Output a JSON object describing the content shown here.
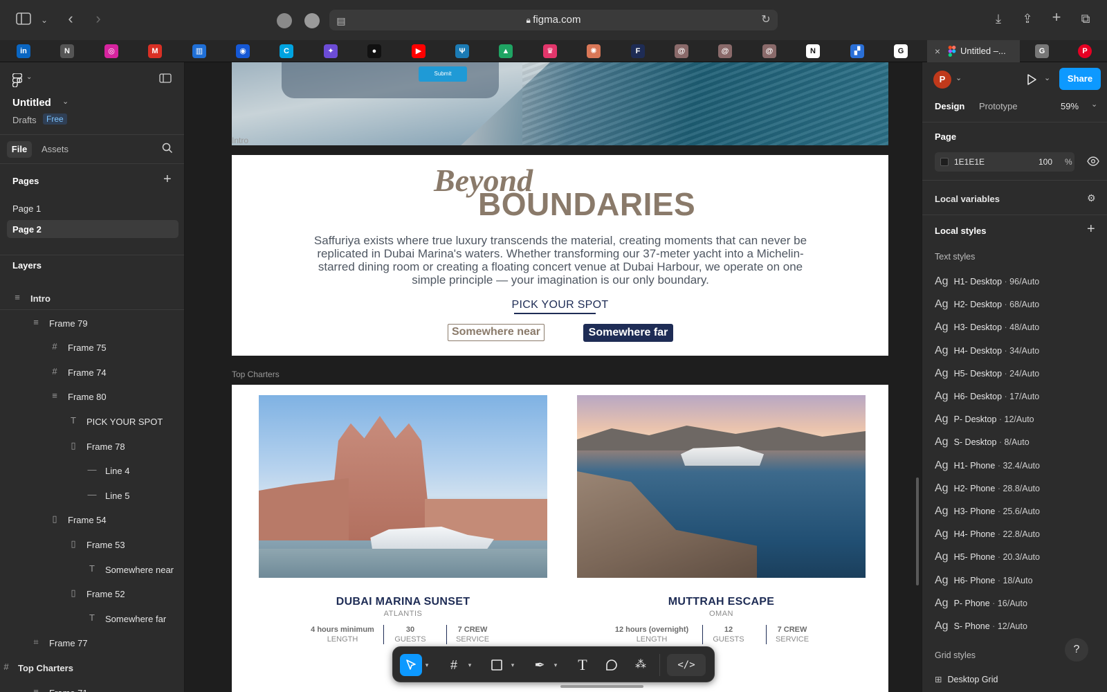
{
  "browser": {
    "url": "figma.com",
    "active_tab_title": "Untitled –..."
  },
  "favicons": [
    {
      "name": "linkedin",
      "glyph": "in",
      "color": "#0a66c2"
    },
    {
      "name": "notion",
      "glyph": "N",
      "color": "#555555"
    },
    {
      "name": "instagram",
      "glyph": "◎",
      "color": "#d6249f"
    },
    {
      "name": "gmail",
      "glyph": "M",
      "color": "#d93025"
    },
    {
      "name": "analytics",
      "glyph": "▥",
      "color": "#1f6fd6"
    },
    {
      "name": "app-blue",
      "glyph": "◉",
      "color": "#1558d6"
    },
    {
      "name": "canva",
      "glyph": "C",
      "color": "#00a3e0"
    },
    {
      "name": "app-purple",
      "glyph": "✦",
      "color": "#6c4cd6"
    },
    {
      "name": "app-black",
      "glyph": "●",
      "color": "#111111"
    },
    {
      "name": "youtube",
      "glyph": "▶",
      "color": "#ff0000"
    },
    {
      "name": "app-teal",
      "glyph": "Ψ",
      "color": "#1b7bb5"
    },
    {
      "name": "google-drive",
      "glyph": "▲",
      "color": "#1fa463"
    },
    {
      "name": "app-crown",
      "glyph": "♛",
      "color": "#e2366b"
    },
    {
      "name": "claude",
      "glyph": "✺",
      "color": "#d97757"
    },
    {
      "name": "app-f",
      "glyph": "F",
      "color": "#1e2c55"
    },
    {
      "name": "app-swirl-1",
      "glyph": "@",
      "color": "#8a6a6a"
    },
    {
      "name": "app-swirl-2",
      "glyph": "@",
      "color": "#8a6a6a"
    },
    {
      "name": "app-swirl-3",
      "glyph": "@",
      "color": "#8a6a6a"
    },
    {
      "name": "app-n",
      "glyph": "N",
      "color": "#ffffff"
    },
    {
      "name": "app-bars",
      "glyph": "▞",
      "color": "#2a6fd6"
    },
    {
      "name": "google",
      "glyph": "G",
      "color": "#ffffff"
    }
  ],
  "left_panel": {
    "file_name": "Untitled",
    "location": "Drafts",
    "plan_badge": "Free",
    "tab_file": "File",
    "tab_assets": "Assets",
    "pages_heading": "Pages",
    "pages": [
      "Page 1",
      "Page 2"
    ],
    "layers_heading": "Layers",
    "layers": [
      {
        "name": "Intro",
        "icon": "≡"
      },
      {
        "name": "Frame 79",
        "icon": "≡"
      },
      {
        "name": "Frame 75",
        "icon": "#"
      },
      {
        "name": "Frame 74",
        "icon": "#"
      },
      {
        "name": "Frame 80",
        "icon": "≡"
      },
      {
        "name": "PICK YOUR SPOT",
        "icon": "T"
      },
      {
        "name": "Frame 78",
        "icon": "▯"
      },
      {
        "name": "Line 4",
        "icon": "—"
      },
      {
        "name": "Line 5",
        "icon": "—"
      },
      {
        "name": "Frame 54",
        "icon": "▯"
      },
      {
        "name": "Frame 53",
        "icon": "▯"
      },
      {
        "name": "Somewhere near",
        "icon": "T"
      },
      {
        "name": "Frame 52",
        "icon": "▯"
      },
      {
        "name": "Somewhere far",
        "icon": "T"
      },
      {
        "name": "Frame 77",
        "icon": "⌗"
      },
      {
        "name": "Top Charters",
        "icon": "#"
      },
      {
        "name": "Frame 71",
        "icon": "≡"
      }
    ]
  },
  "canvas": {
    "submit_label": "Submit",
    "intro_label": "Intro",
    "beyond": "Beyond",
    "boundaries": "BOUNDARIES",
    "intro_body": "Saffuriya exists where true luxury transcends the material, creating moments that can never be replicated in Dubai Marina's waters. Whether transforming our 37-meter yacht into a Michelin-starred dining room or creating a floating concert venue at Dubai Harbour, we operate on one simple principle — your imagination is our only boundary.",
    "pick_spot": "PICK YOUR SPOT",
    "btn_near": "Somewhere near",
    "btn_far": "Somewhere far",
    "top_charters_label": "Top Charters",
    "cards": [
      {
        "title": "DUBAI MARINA SUNSET",
        "subtitle": "ATLANTIS",
        "stats": [
          {
            "value": "4 hours minimum",
            "label": "LENGTH"
          },
          {
            "value": "30",
            "label": "GUESTS"
          },
          {
            "value": "7 CREW",
            "label": "SERVICE"
          }
        ]
      },
      {
        "title": "MUTTRAH ESCAPE",
        "subtitle": "OMAN",
        "stats": [
          {
            "value": "12 hours (overnight)",
            "label": "LENGTH"
          },
          {
            "value": "12",
            "label": "GUESTS"
          },
          {
            "value": "7 CREW",
            "label": "SERVICE"
          }
        ]
      }
    ]
  },
  "right_panel": {
    "avatar_initial": "P",
    "avatar_color": "#c0391b",
    "share_label": "Share",
    "tab_design": "Design",
    "tab_prototype": "Prototype",
    "zoom": "59%",
    "page_heading": "Page",
    "page_color_hex": "1E1E1E",
    "page_opacity": "100",
    "percent_sign": "%",
    "local_variables": "Local variables",
    "local_styles": "Local styles",
    "text_styles_heading": "Text styles",
    "text_styles": [
      {
        "name": "H1- Desktop",
        "size": "96/Auto"
      },
      {
        "name": "H2- Desktop",
        "size": "68/Auto"
      },
      {
        "name": "H3- Desktop",
        "size": "48/Auto"
      },
      {
        "name": "H4- Desktop",
        "size": "34/Auto"
      },
      {
        "name": "H5- Desktop",
        "size": "24/Auto"
      },
      {
        "name": "H6- Desktop",
        "size": "17/Auto"
      },
      {
        "name": "P- Desktop",
        "size": "12/Auto"
      },
      {
        "name": "S- Desktop",
        "size": "8/Auto"
      },
      {
        "name": "H1- Phone",
        "size": "32.4/Auto"
      },
      {
        "name": "H2- Phone",
        "size": "28.8/Auto"
      },
      {
        "name": "H3- Phone",
        "size": "25.6/Auto"
      },
      {
        "name": "H4- Phone",
        "size": "22.8/Auto"
      },
      {
        "name": "H5- Phone",
        "size": "20.3/Auto"
      },
      {
        "name": "H6- Phone",
        "size": "18/Auto"
      },
      {
        "name": "P- Phone",
        "size": "16/Auto"
      },
      {
        "name": "S- Phone",
        "size": "12/Auto"
      }
    ],
    "ag_glyph": "Ag",
    "grid_styles_heading": "Grid styles",
    "grid_style_first": "Desktop Grid",
    "help_glyph": "?"
  },
  "colors": {
    "accent_blue": "#0d99ff",
    "brand_navy": "#1e2c55",
    "brand_taupe": "#8a7a6a"
  }
}
